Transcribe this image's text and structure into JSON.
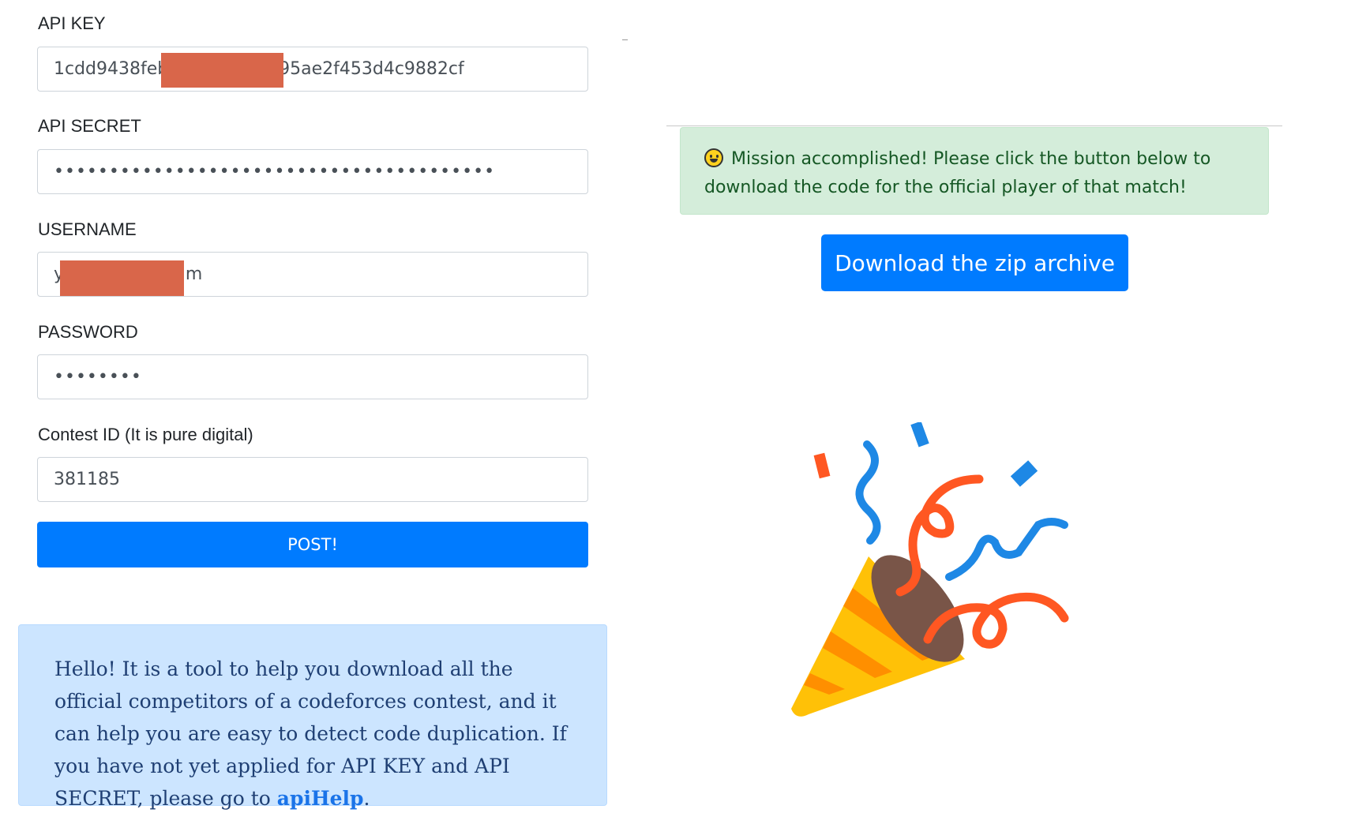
{
  "form": {
    "api_key": {
      "label": "API KEY",
      "value": "1cdd9438feb                    95ae2f453d4c9882cf"
    },
    "api_secret": {
      "label": "API SECRET",
      "value": "••••••••••••••••••••••••••••••••••••••••"
    },
    "username": {
      "label": "USERNAME",
      "value": "y                      m"
    },
    "password": {
      "label": "PASSWORD",
      "value": "••••••••"
    },
    "contest_id": {
      "label": "Contest ID (It is pure digital)",
      "value": "381185"
    },
    "submit_label": "POST!"
  },
  "info": {
    "text": "Hello! It is a tool to help you download all the official competitors of a codeforces contest, and it can help you are easy to detect code duplication. If you have not yet applied for API KEY and API SECRET, please go to ",
    "link_text": "apiHelp",
    "after_link": "."
  },
  "result": {
    "message": "Mission accomplished! Please click the button below to download the code for the official player of that match!",
    "download_label": "Download the zip archive",
    "icon": "grinning-face-icon",
    "illustration": "party-popper-icon"
  },
  "colors": {
    "primary": "#007bff",
    "success_bg": "#d4edda",
    "info_bg": "#cce5ff",
    "redaction": "#d9664a"
  }
}
